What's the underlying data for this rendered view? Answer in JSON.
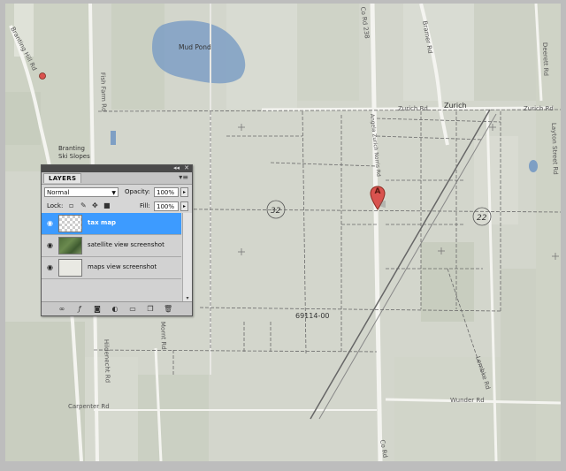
{
  "map": {
    "places": {
      "mud_pond": "Mud Pond",
      "zurich": "Zurich",
      "branting_ski_slopes_1": "Branting",
      "branting_ski_slopes_2": "Ski Slopes"
    },
    "roads": {
      "branting_hill": "Branting Hill Rd",
      "fish_farm": "Fish Farm Rd",
      "co_rd_238": "Co Rd 238",
      "bramer": "Bramer Rd",
      "zurich_rd_left": "Zurich Rd",
      "zurich_rd_right": "Zurich Rd",
      "layton": "Layton Street Rd",
      "deerett": "Deerett Rd",
      "hildenecht": "Hildenecht Rd",
      "carpenter": "Carpenter Rd",
      "wunder": "Wunder Rd",
      "lembke": "Lembke Rd",
      "co_rd_bottom": "Co Rd",
      "angela_zurich_norris": "Angela Zurich Norris Rd",
      "mornt": "Mornt Rd"
    },
    "sections": {
      "s32": "32",
      "s22": "22"
    },
    "parcel_number": "69114-00",
    "marker_letter": "A"
  },
  "layers_panel": {
    "tab_label": "LAYERS",
    "collapse_glyph": "◂◂",
    "close_glyph": "✕",
    "menu_glyph": "▾≡",
    "blend_mode": "Normal",
    "opacity_label": "Opacity:",
    "opacity_value": "100%",
    "lock_label": "Lock:",
    "fill_label": "Fill:",
    "fill_value": "100%",
    "layers": [
      {
        "name": "tax map",
        "selected": true
      },
      {
        "name": "satellite view screenshot",
        "selected": false
      },
      {
        "name": "maps view screenshot",
        "selected": false
      }
    ]
  },
  "colors": {
    "selection": "#3d9bff",
    "water": "#7e9fc4",
    "map_base": "#d5d8cf",
    "marker": "#d9534f"
  }
}
